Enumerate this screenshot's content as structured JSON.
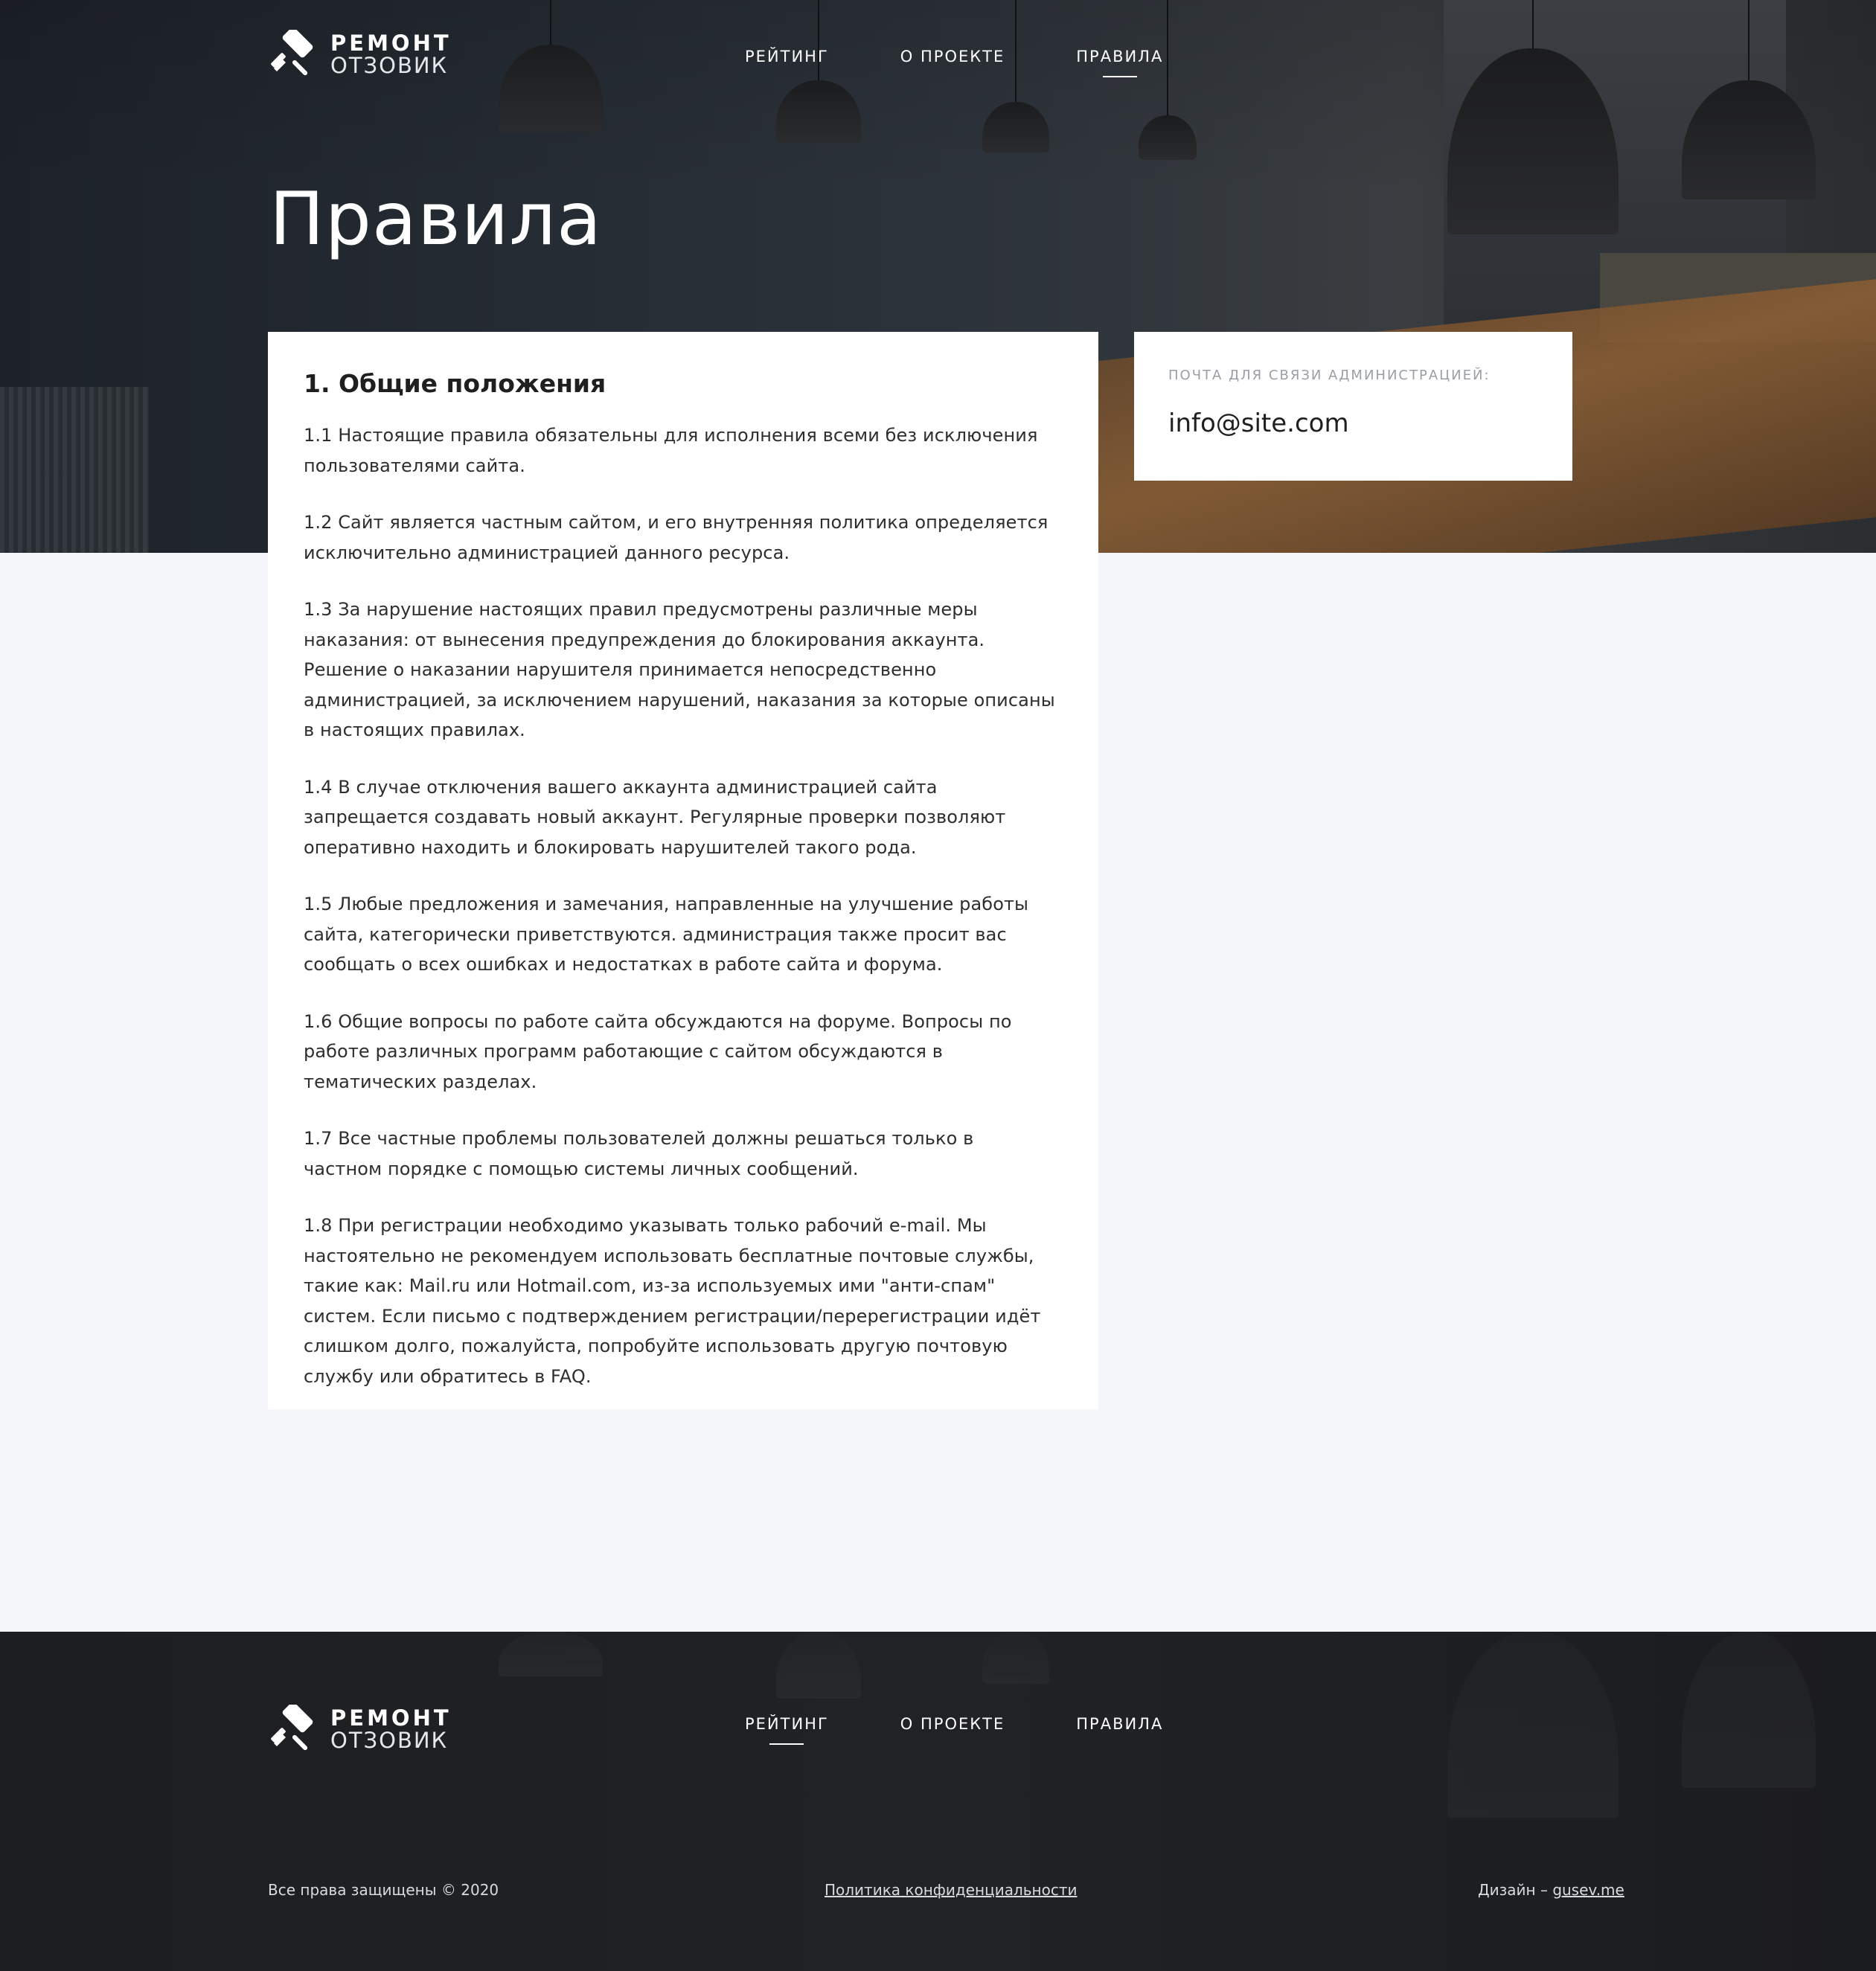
{
  "brand": {
    "top": "РЕМОНТ",
    "bottom": "ОТЗОВИК"
  },
  "nav": {
    "items": [
      {
        "label": "РЕЙТИНГ"
      },
      {
        "label": "О ПРОЕКТЕ"
      },
      {
        "label": "ПРАВИЛА"
      }
    ],
    "active_index": 2
  },
  "hero": {
    "title": "Правила"
  },
  "rules": {
    "heading": "1. Общие положения",
    "paragraphs": [
      "1.1 Настоящие правила обязательны для исполнения всеми без исключения пользователями сайта.",
      "1.2 Сайт является частным сайтом, и его внутренняя политика определяется исключительно администрацией данного ресурса.",
      "1.3 За нарушение настоящих правил предусмотрены различные меры наказания: от вынесения предупреждения до блокирования аккаунта. Решение о наказании нарушителя принимается непосредственно администрацией, за исключением нарушений, наказания за которые описаны в настоящих правилах.",
      "1.4 В случае отключения вашего аккаунта администрацией сайта запрещается создавать новый аккаунт. Регулярные проверки позволяют оперативно находить и блокировать нарушителей такого рода.",
      "1.5 Любые предложения и замечания, направленные на улучшение работы сайта, категорически приветствуются. администрация также просит вас сообщать о всех ошибках и недостатках в работе сайта и форума.",
      "1.6 Общие вопросы по работе сайта обсуждаются на форуме. Вопросы по работе различных программ работающие с сайтом обсуждаются в тематических разделах.",
      "1.7 Все частные проблемы пользователей должны решаться только в частном порядке с помощью системы личных сообщений.",
      "1.8 При регистрации необходимо указывать только рабочий e-mail. Мы настоятельно не рекомендуем использовать бесплатные почтовые службы, такие как: Mail.ru или Hotmail.com, из-за используемых ими \"анти-спам\" систем. Если письмо с подтверждением регистрации/перерегистрации идёт слишком долго, пожалуйста, попробуйте использовать другую почтовую службу или обратитесь в FAQ."
    ]
  },
  "contact": {
    "label": "ПОЧТА ДЛЯ СВЯЗИ АДМИНИСТРАЦИЕЙ:",
    "email": "info@site.com"
  },
  "footer": {
    "nav": {
      "items": [
        {
          "label": "РЕЙТИНГ"
        },
        {
          "label": "О ПРОЕКТЕ"
        },
        {
          "label": "ПРАВИЛА"
        }
      ],
      "active_index": 0
    },
    "copyright": "Все права защищены © 2020",
    "privacy": "Политика конфиденциальности",
    "design_prefix": "Дизайн – ",
    "design_link": "gusev.me"
  },
  "colors": {
    "page_bg": "#f5f6fa",
    "card_bg": "#ffffff",
    "hero_dark": "#262c34",
    "footer_dark": "#1f2124",
    "label_gray": "#9a9ea6"
  },
  "icons": {
    "logo": "paint-roller-icon"
  }
}
